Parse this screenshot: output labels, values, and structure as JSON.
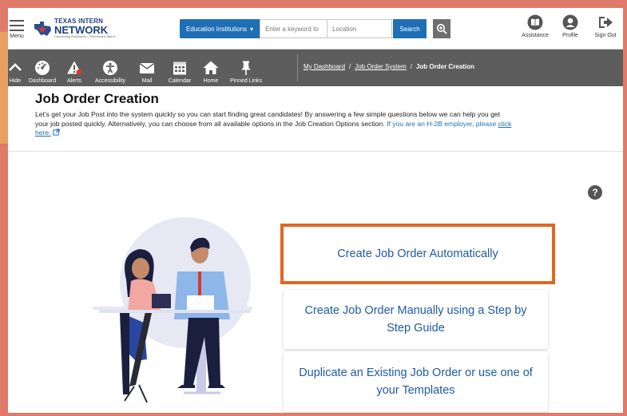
{
  "header": {
    "menu_label": "Menu",
    "logo_line1": "TEXAS INTERN",
    "logo_line2": "NETWORK",
    "logo_tagline": "Connecting Employers • Tomorrow's Talent",
    "institution_dropdown": "Education Institutions",
    "keyword_placeholder": "Enter a keyword to",
    "location_placeholder": "Location",
    "search_label": "Search",
    "right_items": [
      {
        "label": "Assistance",
        "icon": "book-icon"
      },
      {
        "label": "Profile",
        "icon": "user-icon"
      },
      {
        "label": "Sign Out",
        "icon": "sign-out-icon"
      }
    ]
  },
  "nav": {
    "items": [
      {
        "label": "Hide",
        "icon": "chevron-up-icon"
      },
      {
        "label": "Dashboard",
        "icon": "dashboard-icon"
      },
      {
        "label": "Alerts",
        "icon": "alert-icon"
      },
      {
        "label": "Accessibility",
        "icon": "accessibility-icon"
      },
      {
        "label": "Mail",
        "icon": "mail-icon"
      },
      {
        "label": "Calendar",
        "icon": "calendar-icon"
      },
      {
        "label": "Home",
        "icon": "home-icon"
      },
      {
        "label": "Pinned Links",
        "icon": "pin-icon"
      }
    ],
    "breadcrumb": {
      "dashboard": "My Dashboard",
      "sep": "/",
      "job_order_system": "Job Order System",
      "current": "Job Order Creation"
    }
  },
  "main": {
    "title": "Job Order Creation",
    "intro_text": "Let's get your Job Post into the system quickly so you can start finding great candidates! By answering a few simple questions below we can help you get your job posted quickly. Alternatively, you can choose from all available options in the Job Creation Options section.",
    "h2b_text": "If you are an H-2B employer, please",
    "h2b_link": "click here.",
    "help_icon": "?",
    "options": {
      "automatic": "Create Job Order Automatically",
      "manual": "Create Job Order Manually using a Step by Step Guide",
      "duplicate": "Duplicate an Existing Job Order or use one of your Templates"
    }
  },
  "colors": {
    "brand_blue": "#1f6fb5",
    "nav_grey": "#5d5d5d",
    "highlight_orange": "#e1671f",
    "frame_salmon": "#e07a6a"
  }
}
